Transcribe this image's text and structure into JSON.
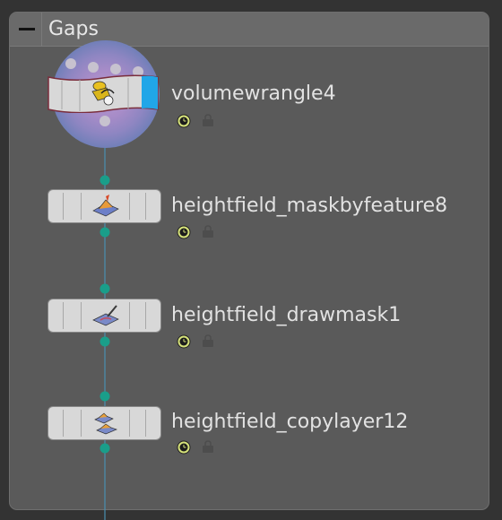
{
  "network_box": {
    "title": "Gaps"
  },
  "nodes": [
    {
      "name": "volumewrangle4",
      "icon": "wrangle-icon",
      "selected": true,
      "display_flag": true
    },
    {
      "name": "heightfield_maskbyfeature8",
      "icon": "maskbyfeature-icon",
      "selected": false,
      "display_flag": false
    },
    {
      "name": "heightfield_drawmask1",
      "icon": "drawmask-icon",
      "selected": false,
      "display_flag": false
    },
    {
      "name": "heightfield_copylayer12",
      "icon": "copylayer-icon",
      "selected": false,
      "display_flag": false
    }
  ],
  "colors": {
    "background": "#333333",
    "netbox": "#5a5a5a",
    "wire": "#1a9e8a",
    "wire_line": "#4a8fb0",
    "display_flag": "#21a6e8",
    "node_body": "#d8d8d8",
    "text": "#e2e2e2"
  }
}
